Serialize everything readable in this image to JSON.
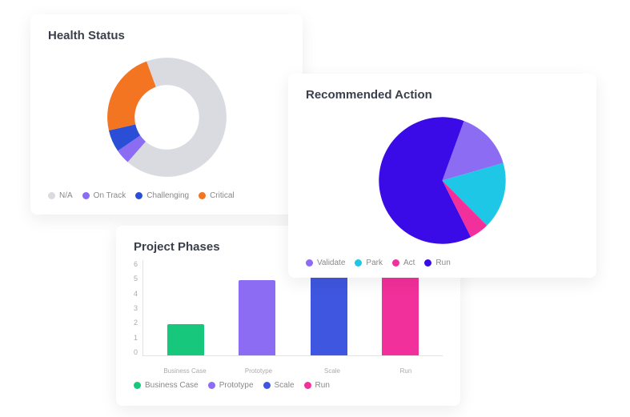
{
  "health": {
    "title": "Health Status",
    "legend": [
      {
        "label": "N/A",
        "color": "#d9dbe0"
      },
      {
        "label": "On Track",
        "color": "#8c6cf2"
      },
      {
        "label": "Challenging",
        "color": "#2a4fd6"
      },
      {
        "label": "Critical",
        "color": "#f37421"
      }
    ]
  },
  "action": {
    "title": "Recommended Action",
    "legend": [
      {
        "label": "Validate",
        "color": "#8c6cf2"
      },
      {
        "label": "Park",
        "color": "#1ec7e6"
      },
      {
        "label": "Act",
        "color": "#f2309b"
      },
      {
        "label": "Run",
        "color": "#3a0be6"
      }
    ]
  },
  "phases": {
    "title": "Project Phases",
    "legend": [
      {
        "label": "Business Case",
        "color": "#17c77c"
      },
      {
        "label": "Prototype",
        "color": "#8c6cf2"
      },
      {
        "label": "Scale",
        "color": "#3f57e0"
      },
      {
        "label": "Run",
        "color": "#f2309b"
      }
    ],
    "yticks": [
      "6",
      "5",
      "4",
      "3",
      "2",
      "1",
      "0"
    ],
    "xlabels": [
      "Business Case",
      "Prototype",
      "Scale",
      "Run"
    ]
  },
  "chart_data": [
    {
      "type": "pie",
      "title": "Health Status",
      "donut": true,
      "series": [
        {
          "name": "N/A",
          "value": 67,
          "color": "#d9dbe0"
        },
        {
          "name": "On Track",
          "value": 4,
          "color": "#8c6cf2"
        },
        {
          "name": "Challenging",
          "value": 6,
          "color": "#2a4fd6"
        },
        {
          "name": "Critical",
          "value": 23,
          "color": "#f37421"
        }
      ]
    },
    {
      "type": "pie",
      "title": "Recommended Action",
      "donut": false,
      "series": [
        {
          "name": "Validate",
          "value": 15,
          "color": "#8c6cf2"
        },
        {
          "name": "Park",
          "value": 17,
          "color": "#1ec7e6"
        },
        {
          "name": "Act",
          "value": 5,
          "color": "#f2309b"
        },
        {
          "name": "Run",
          "value": 63,
          "color": "#3a0be6"
        }
      ]
    },
    {
      "type": "bar",
      "title": "Project Phases",
      "categories": [
        "Business Case",
        "Prototype",
        "Scale",
        "Run"
      ],
      "values": [
        2,
        4.8,
        5.8,
        5.8
      ],
      "colors": [
        "#17c77c",
        "#8c6cf2",
        "#3f57e0",
        "#f2309b"
      ],
      "ylim": [
        0,
        6
      ],
      "xlabel": "",
      "ylabel": ""
    }
  ]
}
